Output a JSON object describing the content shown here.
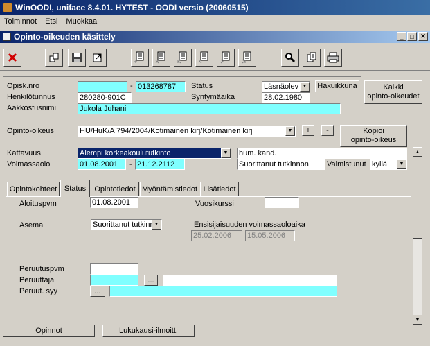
{
  "app": {
    "title": "WinOODI, uniface 8.4.01. HYTEST - OODI versio (20060515)"
  },
  "menu": [
    "Toiminnot",
    "Etsi",
    "Muokkaa"
  ],
  "window": {
    "title": "Opinto-oikeuden käsittely"
  },
  "student": {
    "opisk_nro_label": "Opisk.nro",
    "opisk_nro_prefix": "",
    "opisk_nro": "013268787",
    "henkilotunnus_label": "Henkilötunnus",
    "henkilotunnus": "280280-901C",
    "aakkostusnimi_label": "Aakkostusnimi",
    "aakkostusnimi": "Jukola Juhani",
    "status_label": "Status",
    "status": "Läsnäolev",
    "syntymaaika_label": "Syntymäaika",
    "syntymaaika": "28.02.1980",
    "hakuikkuna": "Hakuikkuna",
    "kaikki_line1": "Kaikki",
    "kaikki_line2": "opinto-oikeudet",
    "dash": "-"
  },
  "right": {
    "opinto_oikeus_label": "Opinto-oikeus",
    "opinto_oikeus": "HU/HuK/A 794/2004/Kotimainen kirj/Kotimainen kirj",
    "plus": "+",
    "minus": "-",
    "kopioi_line1": "Kopioi",
    "kopioi_line2": "opinto-oikeus",
    "kattavuus_label": "Kattavuus",
    "kattavuus": "Alempi korkeakoulututkinto",
    "kattavuus_abbr": "hum. kand.",
    "voimassaolo_label": "Voimassaolo",
    "voimassa_from": "01.08.2001",
    "voimassa_to": "21.12.2112",
    "tutkinto": "Suorittanut tutkinnon",
    "valmistunut_label": "Valmistunut",
    "valmistunut": "kyllä"
  },
  "tabs": [
    "Opintokohteet",
    "Status",
    "Opintotiedot",
    "Myöntämistiedot",
    "Lisätiedot"
  ],
  "status_tab": {
    "aloituspvm_label": "Aloituspvm",
    "aloituspvm": "01.08.2001",
    "vuosikurssi_label": "Vuosikurssi",
    "vuosikurssi": "",
    "asema_label": "Asema",
    "asema": "Suorittanut tutkinr",
    "ensisijaisuus_label": "Ensisijaisuuden voimassaoloaika",
    "ens_from": "25.02.2006",
    "ens_to": "15.05.2006",
    "peruutuspvm_label": "Peruutuspvm",
    "peruutuspvm": "",
    "peruuttaja_label": "Peruuttaja",
    "peruuttaja": "",
    "peruuttaja_name": "",
    "peruut_syy_label": "Peruut. syy",
    "peruut_syy": "",
    "ellipsis": "..."
  },
  "bottom": {
    "opinnot": "Opinnot",
    "lukukausi": "Lukukausi-ilmoitt."
  },
  "toolbar": [
    "close-icon",
    "replace-icon",
    "save-icon",
    "export-icon",
    "new-record-icon",
    "delete-record-icon",
    "first-record-icon",
    "prev-record-icon",
    "next-record-icon",
    "last-record-icon",
    "search-icon",
    "copy-icon",
    "print-icon"
  ]
}
